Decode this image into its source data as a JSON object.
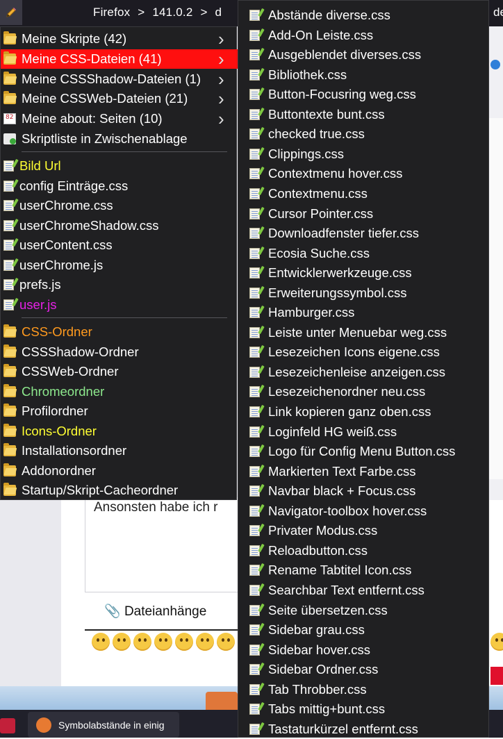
{
  "toolbar": {
    "breadcrumb": [
      "Firefox",
      ">",
      "141.0.2",
      ">",
      "d"
    ],
    "right_fragment": "de"
  },
  "page": {
    "text_fragment": "Ansonsten habe ich r",
    "attachments_label": "Dateianhänge",
    "task_title": "Symbolabstände in einig"
  },
  "menu": {
    "items": [
      {
        "label": "Meine Skripte (42)",
        "icon": "folder-icon",
        "submenu": true,
        "color": "#ffffff"
      },
      {
        "label": "Meine CSS-Dateien (41)",
        "icon": "folder-icon",
        "submenu": true,
        "color": "#ffffff",
        "highlighted": true
      },
      {
        "label": "Meine CSSShadow-Dateien (1)",
        "icon": "folder-icon",
        "submenu": true,
        "color": "#ffffff"
      },
      {
        "label": "Meine CSSWeb-Dateien (21)",
        "icon": "folder-icon",
        "submenu": true,
        "color": "#ffffff"
      },
      {
        "label": "Meine about: Seiten (10)",
        "icon": "about-page-icon",
        "submenu": true,
        "color": "#ffffff"
      },
      {
        "label": "Skriptliste in Zwischenablage",
        "icon": "clipboard-icon",
        "submenu": false,
        "color": "#ffffff"
      },
      {
        "separator": true
      },
      {
        "label": "Bild Url",
        "icon": "file-icon",
        "color": "#ffff33"
      },
      {
        "label": "config Einträge.css",
        "icon": "file-icon",
        "color": "#ffffff"
      },
      {
        "label": "userChrome.css",
        "icon": "file-icon",
        "color": "#ffffff"
      },
      {
        "label": "userChromeShadow.css",
        "icon": "file-icon",
        "color": "#ffffff"
      },
      {
        "label": "userContent.css",
        "icon": "file-icon",
        "color": "#ffffff"
      },
      {
        "label": "userChrome.js",
        "icon": "file-icon",
        "color": "#ffffff"
      },
      {
        "label": "prefs.js",
        "icon": "file-icon",
        "color": "#ffffff"
      },
      {
        "label": "user.js",
        "icon": "file-icon",
        "color": "#e620e6"
      },
      {
        "separator": true
      },
      {
        "label": "CSS-Ordner",
        "icon": "folder-icon",
        "color": "#ff9a1f"
      },
      {
        "label": "CSSShadow-Ordner",
        "icon": "folder-icon",
        "color": "#ffffff"
      },
      {
        "label": "CSSWeb-Ordner",
        "icon": "folder-icon",
        "color": "#ffffff"
      },
      {
        "label": "Chromeordner",
        "icon": "folder-icon",
        "color": "#8de88d"
      },
      {
        "label": "Profilordner",
        "icon": "folder-icon",
        "color": "#ffffff"
      },
      {
        "label": "Icons-Ordner",
        "icon": "folder-icon",
        "color": "#ffff33"
      },
      {
        "label": "Installationsordner",
        "icon": "folder-icon",
        "color": "#ffffff"
      },
      {
        "label": "Addonordner",
        "icon": "folder-icon",
        "color": "#ffffff"
      },
      {
        "label": "Startup/Skript-Cacheordner",
        "icon": "folder-icon",
        "color": "#ffffff"
      }
    ]
  },
  "submenu": {
    "items": [
      "Abstände diverse.css",
      "Add-On Leiste.css",
      "Ausgeblendet diverses.css",
      "Bibliothek.css",
      "Button-Focusring weg.css",
      "Buttontexte bunt.css",
      "checked true.css",
      "Clippings.css",
      "Contextmenu hover.css",
      "Contextmenu.css",
      "Cursor Pointer.css",
      "Downloadfenster tiefer.css",
      "Ecosia Suche.css",
      "Entwicklerwerkzeuge.css",
      "Erweiterungssymbol.css",
      "Hamburger.css",
      "Leiste unter Menuebar weg.css",
      "Lesezeichen Icons eigene.css",
      "Lesezeichenleise anzeigen.css",
      "Lesezeichenordner neu.css",
      "Link kopieren ganz oben.css",
      "Loginfeld HG weiß.css",
      "Logo für Config Menu Button.css",
      "Markierten Text Farbe.css",
      "Navbar black + Focus.css",
      "Navigator-toolbox hover.css",
      "Privater Modus.css",
      "Reloadbutton.css",
      "Rename Tabtitel Icon.css",
      "Searchbar Text entfernt.css",
      "Seite übersetzen.css",
      "Sidebar grau.css",
      "Sidebar hover.css",
      "Sidebar Ordner.css",
      "Tab Throbber.css",
      "Tabs mittig+bunt.css",
      "Tastaturkürzel entfernt.css"
    ]
  },
  "colors": {
    "menu_bg": "#202022",
    "highlight": "#ff0f0f"
  }
}
